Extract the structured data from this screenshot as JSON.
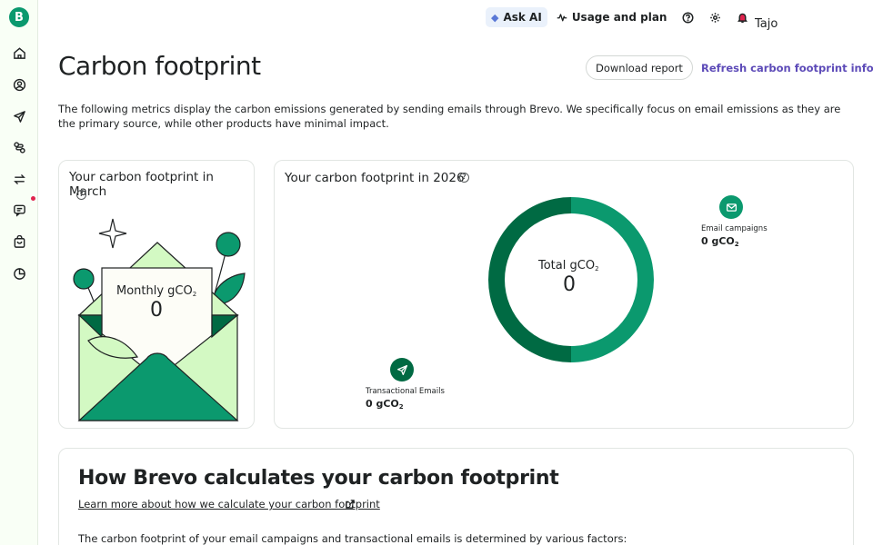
{
  "brand": {
    "logo_letter": "B",
    "accent": "#0b996e"
  },
  "sidebar": {
    "items": [
      {
        "icon": "home-icon"
      },
      {
        "icon": "contacts-icon"
      },
      {
        "icon": "campaigns-icon"
      },
      {
        "icon": "automations-icon"
      },
      {
        "icon": "transactional-icon"
      },
      {
        "icon": "conversations-icon"
      },
      {
        "icon": "sales-icon"
      },
      {
        "icon": "reports-icon"
      }
    ]
  },
  "topbar": {
    "ask_ai": "Ask AI",
    "usage": "Usage and plan",
    "user": "Tajo"
  },
  "header": {
    "title": "Carbon footprint",
    "download": "Download report",
    "refresh": "Refresh carbon footprint info",
    "intro": "The following metrics display the carbon emissions generated by sending emails through Brevo. We specifically focus on email emissions as they are the primary source, while other products have minimal impact."
  },
  "month_card": {
    "title": "Your carbon footprint in March",
    "label": "Monthly gCO",
    "value": "0"
  },
  "year_card": {
    "title": "Your carbon footprint in 2026",
    "total_label": "Total gCO",
    "total_value": "0",
    "email": {
      "name": "Email campaigns",
      "value": "0 gCO"
    },
    "transactional": {
      "name": "Transactional Emails",
      "value": "0 gCO"
    }
  },
  "how": {
    "title": "How Brevo calculates your carbon footprint",
    "link": "Learn more about how we calculate your carbon footprint",
    "body": "The carbon footprint of your email campaigns and transactional emails is determined by various factors:"
  },
  "colors": {
    "dark_green": "#006a43",
    "mid_green": "#0b996e",
    "light_green": "#d3f9c3",
    "purple_link": "#5d4bb8"
  }
}
